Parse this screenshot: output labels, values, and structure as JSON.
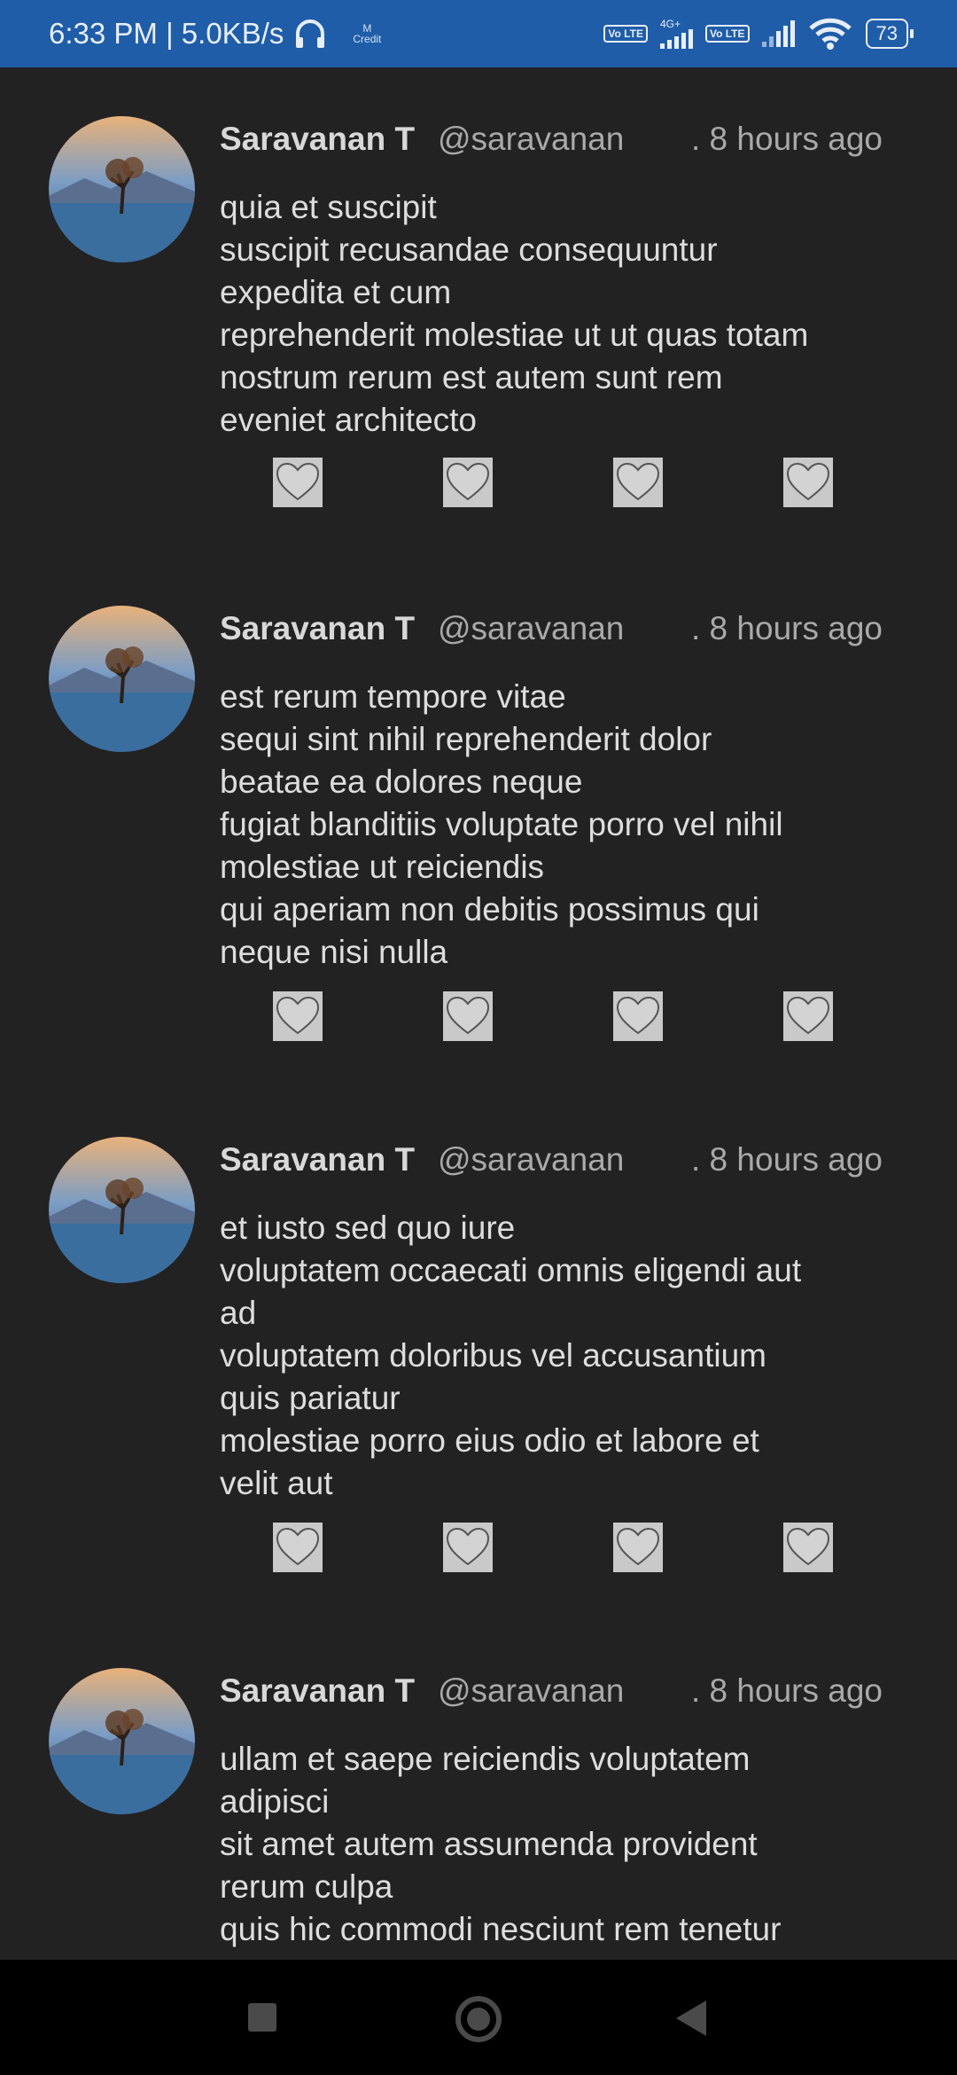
{
  "status_bar": {
    "time_speed": "6:33 PM | 5.0KB/s",
    "network_type": "4G+",
    "volte_label": "Vo LTE",
    "battery": "73",
    "icons": [
      "headphones-icon",
      "mi-credit-icon",
      "volte-icon",
      "signal-icon",
      "wifi-icon",
      "battery-icon"
    ]
  },
  "posts": [
    {
      "name": "Saravanan T",
      "handle": "@saravanan",
      "time": ". 8 hours ago",
      "lines": [
        "quia et suscipit",
        "suscipit recusandae consequuntur",
        "expedita et cum",
        "reprehenderit molestiae ut ut quas totam",
        "nostrum rerum est autem sunt rem",
        "eveniet architecto"
      ]
    },
    {
      "name": "Saravanan T",
      "handle": "@saravanan",
      "time": ". 8 hours ago",
      "lines": [
        "est rerum tempore vitae",
        "sequi sint nihil reprehenderit dolor",
        "beatae ea dolores neque",
        "fugiat blanditiis voluptate porro vel nihil",
        "molestiae ut reiciendis",
        "qui aperiam non debitis possimus qui",
        "neque nisi nulla"
      ]
    },
    {
      "name": "Saravanan T",
      "handle": "@saravanan",
      "time": ". 8 hours ago",
      "lines": [
        "et iusto sed quo iure",
        "voluptatem occaecati omnis eligendi aut",
        "ad",
        "voluptatem doloribus vel accusantium",
        "quis pariatur",
        "molestiae porro eius odio et labore et",
        "velit aut"
      ]
    },
    {
      "name": "Saravanan T",
      "handle": "@saravanan",
      "time": ". 8 hours ago",
      "lines": [
        "ullam et saepe reiciendis voluptatem",
        "adipisci",
        "sit amet autem assumenda provident",
        "rerum culpa",
        "quis hic commodi nesciunt rem tenetur"
      ]
    }
  ],
  "action_icons": [
    "heart-icon",
    "heart-icon",
    "heart-icon",
    "heart-icon"
  ],
  "nav": {
    "icons": [
      "recent-apps-icon",
      "home-icon",
      "back-icon"
    ]
  }
}
